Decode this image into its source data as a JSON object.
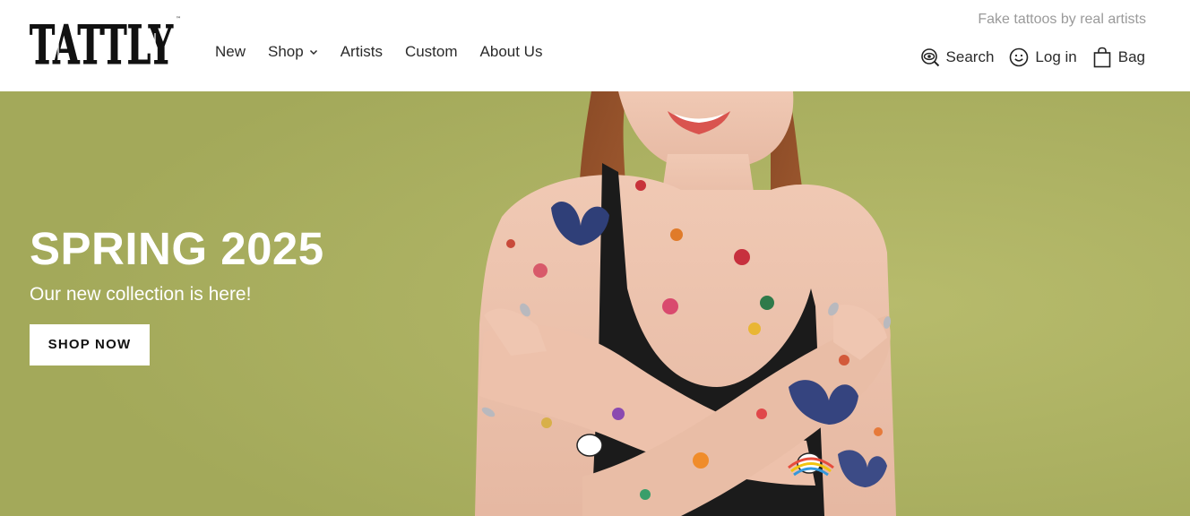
{
  "brand": {
    "logo_text": "TATTLY"
  },
  "header": {
    "tagline": "Fake tattoos by real artists",
    "nav": [
      {
        "label": "New"
      },
      {
        "label": "Shop",
        "has_dropdown": true
      },
      {
        "label": "Artists"
      },
      {
        "label": "Custom"
      },
      {
        "label": "About Us"
      }
    ],
    "utilities": {
      "search": {
        "label": "Search",
        "icon": "eye-search-icon"
      },
      "login": {
        "label": "Log in",
        "icon": "smiley-icon"
      },
      "bag": {
        "label": "Bag",
        "icon": "shopping-bag-icon"
      }
    }
  },
  "hero": {
    "title": "SPRING 2025",
    "subtitle": "Our new collection is here!",
    "cta_label": "SHOP NOW",
    "background_color": "#a9ae5f",
    "image_description_icon": "model-with-tattoos-photo"
  },
  "colors": {
    "text": "#2a2a2a",
    "tagline": "#9a9a9a",
    "hero_bg": "#a9ae5f",
    "cta_bg": "#ffffff"
  }
}
